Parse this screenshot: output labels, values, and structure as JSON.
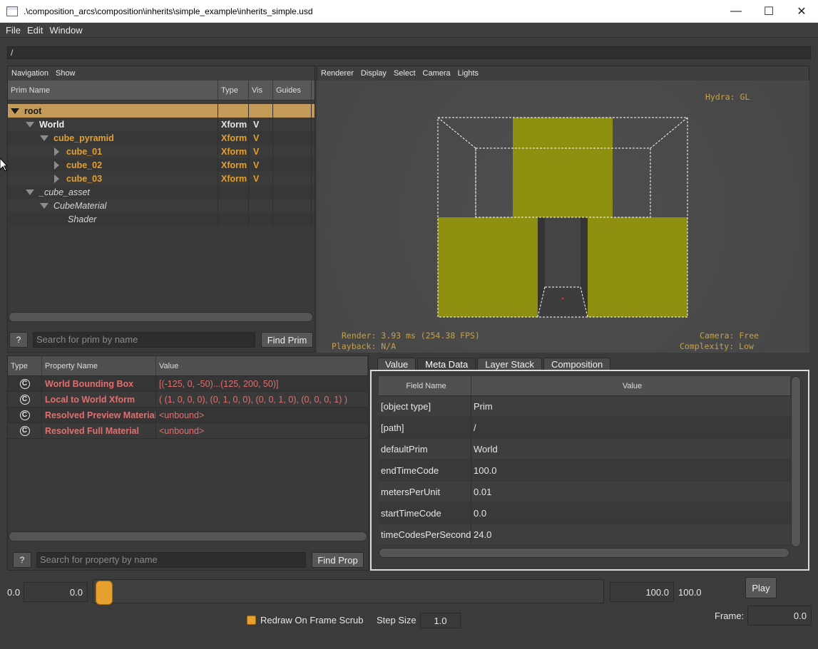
{
  "window": {
    "title": ".\\composition_arcs\\composition\\inherits\\simple_example\\inherits_simple.usd",
    "minimize_glyph": "—",
    "maximize_glyph": "☐",
    "close_glyph": "✕"
  },
  "menubar": {
    "items": [
      "File",
      "Edit",
      "Window"
    ]
  },
  "path_bar": {
    "value": "/"
  },
  "prim_browser": {
    "menu": [
      "Navigation",
      "Show"
    ],
    "columns": [
      "Prim Name",
      "Type",
      "Vis",
      "Guides"
    ],
    "rows": [
      {
        "name": "root",
        "type": "",
        "vis": "",
        "expanded": true
      },
      {
        "name": "World",
        "type": "Xform",
        "vis": "V",
        "expanded": true
      },
      {
        "name": "cube_pyramid",
        "type": "Xform",
        "vis": "V",
        "expanded": true
      },
      {
        "name": "cube_01",
        "type": "Xform",
        "vis": "V",
        "expanded": false
      },
      {
        "name": "cube_02",
        "type": "Xform",
        "vis": "V",
        "expanded": false
      },
      {
        "name": "cube_03",
        "type": "Xform",
        "vis": "V",
        "expanded": false
      },
      {
        "name": "_cube_asset",
        "type": "",
        "vis": "",
        "expanded": true
      },
      {
        "name": "CubeMaterial",
        "type": "",
        "vis": "",
        "expanded": true
      },
      {
        "name": "Shader",
        "type": "",
        "vis": ""
      }
    ],
    "help_label": "?",
    "search_placeholder": "Search for prim by name",
    "find_label": "Find Prim"
  },
  "viewport": {
    "menu": [
      "Renderer",
      "Display",
      "Select",
      "Camera",
      "Lights"
    ],
    "hud_renderer": "Hydra: GL",
    "hud_render": "Render: 3.93 ms (254.38 FPS)",
    "hud_playback": "Playback: N/A",
    "hud_camera": "Camera: Free",
    "hud_complexity": "Complexity: Low",
    "colors": {
      "geometry": "#8f8f0f",
      "geometry_dark": "#3a3a3a",
      "bbox": "#ffffff"
    }
  },
  "properties": {
    "columns": [
      "Type",
      "Property Name",
      "Value"
    ],
    "rows": [
      {
        "icon": "C",
        "name": "World Bounding Box",
        "value": "[(-125, 0, -50)...(125, 200, 50)]"
      },
      {
        "icon": "C",
        "name": "Local to World Xform",
        "value": "( (1, 0, 0, 0), (0, 1, 0, 0), (0, 0, 1, 0), (0, 0, 0, 1) )"
      },
      {
        "icon": "C",
        "name": "Resolved Preview Material",
        "value": "<unbound>"
      },
      {
        "icon": "C",
        "name": "Resolved Full Material",
        "value": "<unbound>"
      }
    ],
    "help_label": "?",
    "search_placeholder": "Search for property by name",
    "find_label": "Find Prop"
  },
  "metadata": {
    "tabs": [
      "Value",
      "Meta Data",
      "Layer Stack",
      "Composition"
    ],
    "active_tab": "Meta Data",
    "columns": [
      "Field Name",
      "Value"
    ],
    "rows": [
      {
        "field": "[object type]",
        "value": "Prim"
      },
      {
        "field": "[path]",
        "value": "/"
      },
      {
        "field": "defaultPrim",
        "value": "World"
      },
      {
        "field": "endTimeCode",
        "value": "100.0"
      },
      {
        "field": "metersPerUnit",
        "value": "0.01"
      },
      {
        "field": "startTimeCode",
        "value": "0.0"
      },
      {
        "field": "timeCodesPerSecond",
        "value": "24.0"
      }
    ]
  },
  "timeline": {
    "range_start_label": "0.0",
    "start_value": "0.0",
    "end_value": "100.0",
    "range_end_label": "100.0",
    "play_label": "Play",
    "frame_label": "Frame:",
    "frame_value": "0.0",
    "redraw_label": "Redraw On Frame Scrub",
    "redraw_checked": true,
    "step_label": "Step Size",
    "step_value": "1.0",
    "accent": "#e5a02e"
  }
}
